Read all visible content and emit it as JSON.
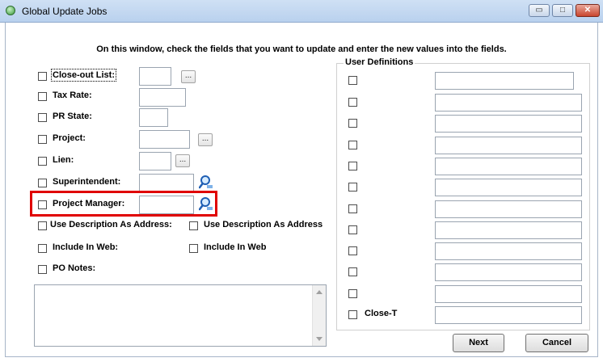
{
  "window": {
    "title": "Global Update Jobs",
    "controls": {
      "minimize": "▭",
      "maximize": "□",
      "close": "✕"
    }
  },
  "instructions": "On this window, check the fields that you want to update and enter the new values into the fields.",
  "fields": {
    "closeout_list": "Close-out List:",
    "tax_rate": "Tax Rate:",
    "pr_state": "PR State:",
    "project": "Project:",
    "lien": "Lien:",
    "superintendent": "Superintendent:",
    "project_manager": "Project Manager:",
    "use_description_as_address": "Use Description As Address:",
    "include_in_web": "Include In Web:",
    "po_notes": "PO Notes:"
  },
  "value_toggles": {
    "use_description_as_address": "Use Description As Address",
    "include_in_web": "Include In Web"
  },
  "browse_button_label": "...",
  "user_definitions": {
    "title": "User Definitions",
    "last_label": "Close-T"
  },
  "buttons": {
    "next": "Next",
    "cancel": "Cancel"
  },
  "colors": {
    "highlight": "#e00000",
    "titlebar": "#c4d8f1"
  },
  "icons": [
    "app-icon",
    "search-icon",
    "minimize-icon",
    "maximize-icon",
    "close-icon"
  ]
}
